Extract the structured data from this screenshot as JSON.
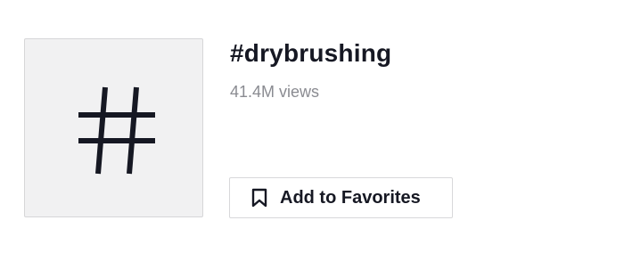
{
  "hashtag": {
    "icon": "hashtag-icon",
    "title": "#drybrushing",
    "views": "41.4M views"
  },
  "favorites_button": {
    "icon": "bookmark-icon",
    "label": "Add to Favorites"
  },
  "colors": {
    "text_primary": "#161823",
    "text_secondary": "#8a8b91",
    "tile_background": "#f1f1f2",
    "border": "#d8d8da"
  }
}
